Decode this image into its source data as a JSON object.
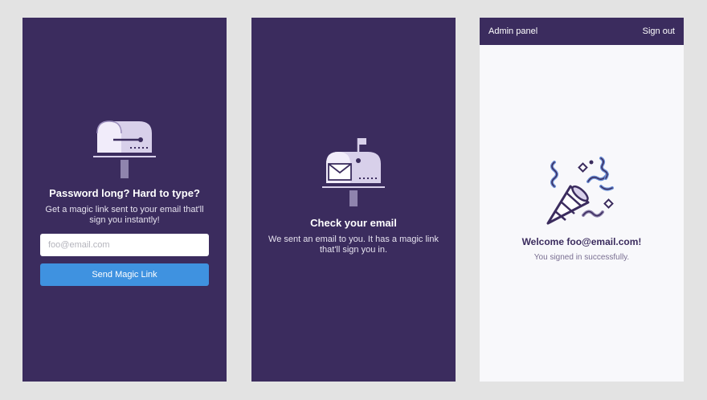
{
  "colors": {
    "purple": "#3b2c5e",
    "button_blue": "#3f92e0",
    "page_background": "#e3e3e3",
    "admin_background": "#f8f8fb"
  },
  "login_screen": {
    "icon": "mailbox-closed-icon",
    "heading": "Password long? Hard to type?",
    "body": "Get a magic link sent to your email that'll sign you instantly!",
    "email_placeholder": "foo@email.com",
    "email_value": "",
    "button_label": "Send Magic Link"
  },
  "check_email_screen": {
    "icon": "mailbox-with-letter-icon",
    "heading": "Check your email",
    "body": "We sent an email to you. It has a magic link that'll sign you in."
  },
  "admin_screen": {
    "header_title": "Admin panel",
    "sign_out_label": "Sign out",
    "icon": "party-popper-icon",
    "welcome": "Welcome foo@email.com!",
    "success": "You signed in successfully."
  }
}
